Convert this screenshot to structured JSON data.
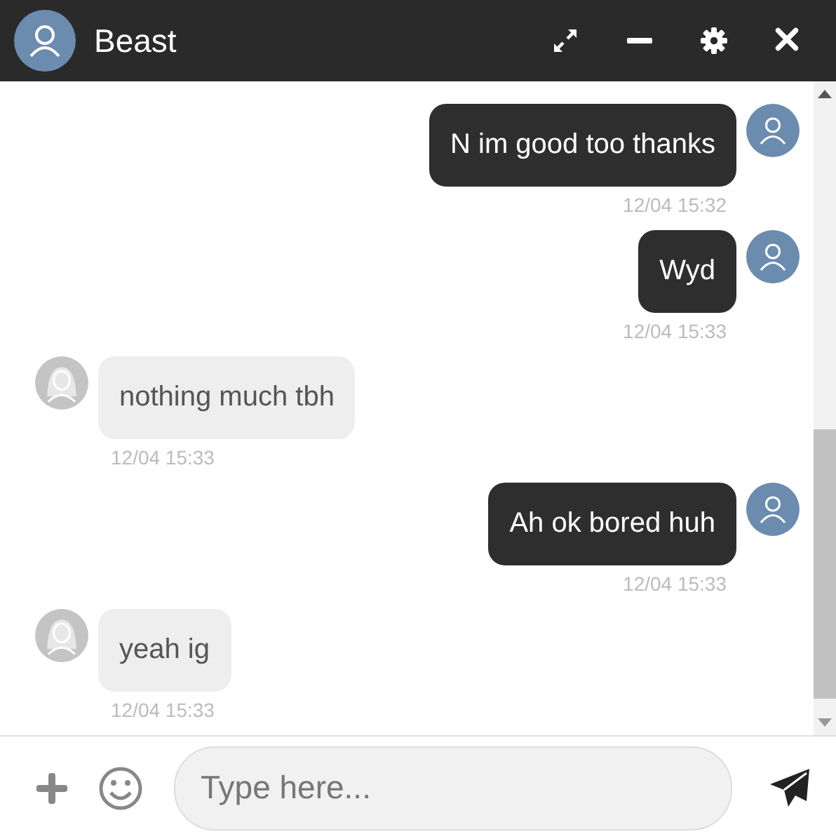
{
  "header": {
    "title": "Beast"
  },
  "messages": [
    {
      "kind": "sent",
      "text": "N im good too thanks",
      "time": "12/04 15:32"
    },
    {
      "kind": "sent",
      "text": "Wyd",
      "time": "12/04 15:33"
    },
    {
      "kind": "received",
      "text": "nothing much tbh",
      "time": "12/04 15:33"
    },
    {
      "kind": "sent",
      "text": "Ah ok bored huh",
      "time": "12/04 15:33"
    },
    {
      "kind": "received",
      "text": "yeah ig",
      "time": "12/04 15:33"
    }
  ],
  "composer": {
    "placeholder": "Type here..."
  }
}
